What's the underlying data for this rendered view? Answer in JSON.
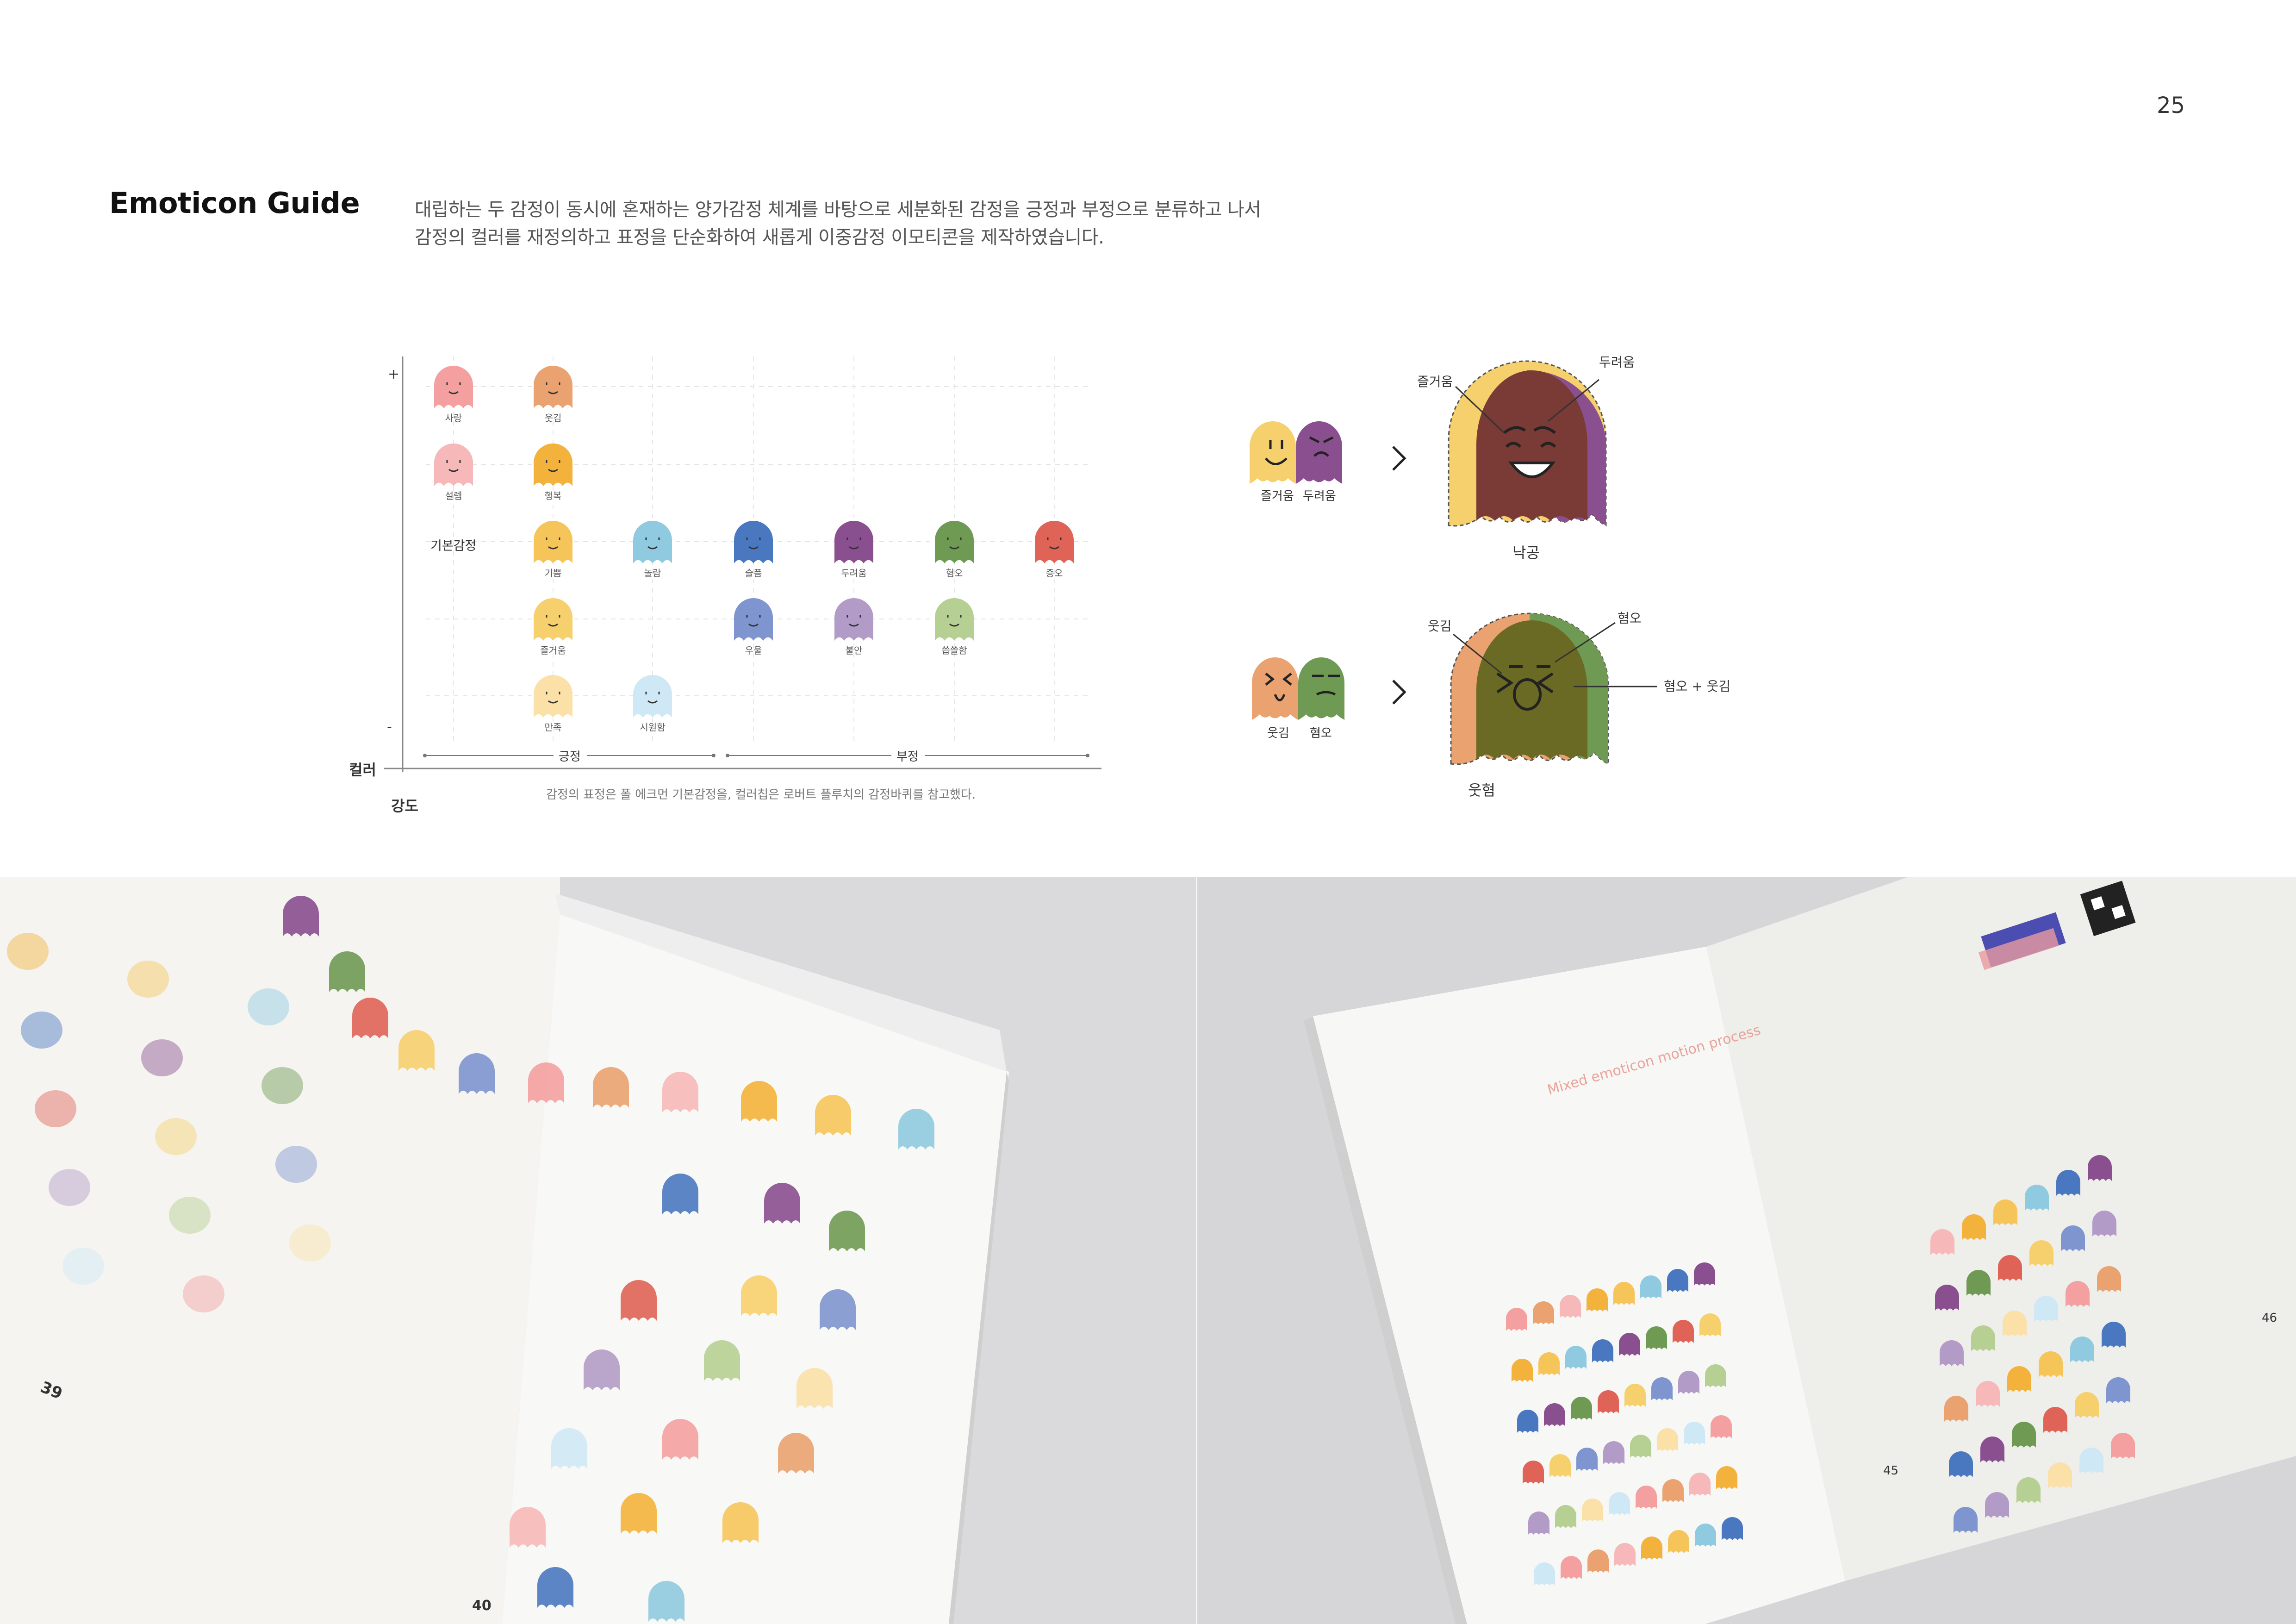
{
  "page_number": "25",
  "title": "Emoticon Guide",
  "description": [
    "대립하는 두 감정이 동시에 혼재하는 양가감정 체계를 바탕으로 세분화된 감정을 긍정과 부정으로 분류하고 나서",
    "감정의 컬러를 재정의하고 표정을 단순화하여 새롭게 이중감정 이모티콘을 제작하였습니다."
  ],
  "chart": {
    "y_plus": "+",
    "y_minus": "-",
    "row_label": "기본감정",
    "axis_color": "컬러",
    "axis_intensity": "강도",
    "group_positive": "긍정",
    "group_negative": "부정",
    "caption": "감정의 표정은 폴 에크먼 기본감정을, 컬러칩은 로버트 플루치의 감정바퀴를 참고했다.",
    "emoticons": [
      {
        "label": "사랑",
        "color": "#f4a0a0",
        "col": 0,
        "row": 0
      },
      {
        "label": "웃김",
        "color": "#e9a270",
        "col": 1,
        "row": 0
      },
      {
        "label": "설렘",
        "color": "#f6b8b8",
        "col": 0,
        "row": 1
      },
      {
        "label": "행복",
        "color": "#f3b23b",
        "col": 1,
        "row": 1
      },
      {
        "label": "기쁨",
        "color": "#f6c55a",
        "col": 1,
        "row": 2
      },
      {
        "label": "놀람",
        "color": "#8fcae0",
        "col": 2,
        "row": 2
      },
      {
        "label": "슬픔",
        "color": "#4a78c0",
        "col": 3,
        "row": 2
      },
      {
        "label": "두려움",
        "color": "#8a4f8f",
        "col": 4,
        "row": 2
      },
      {
        "label": "혐오",
        "color": "#6f9a53",
        "col": 5,
        "row": 2
      },
      {
        "label": "증오",
        "color": "#e06357",
        "col": 6,
        "row": 2
      },
      {
        "label": "즐거움",
        "color": "#f7d06e",
        "col": 1,
        "row": 3
      },
      {
        "label": "우울",
        "color": "#7f95cf",
        "col": 3,
        "row": 3
      },
      {
        "label": "불안",
        "color": "#b39bc7",
        "col": 4,
        "row": 3
      },
      {
        "label": "씁쓸함",
        "color": "#b6cf92",
        "col": 5,
        "row": 3
      },
      {
        "label": "만족",
        "color": "#fbe0a8",
        "col": 1,
        "row": 4
      },
      {
        "label": "시원함",
        "color": "#cfe8f5",
        "col": 2,
        "row": 4
      }
    ]
  },
  "mix_examples": [
    {
      "left_label": "즐거움",
      "right_label": "두려움",
      "left_color": "#f7d06e",
      "right_color": "#8a4f8f",
      "mixed_color": "#7a3a36",
      "callout_left": "즐거움",
      "callout_right": "두려움",
      "result": "낙공"
    },
    {
      "left_label": "웃김",
      "right_label": "혐오",
      "left_color": "#e9a270",
      "right_color": "#6f9a53",
      "mixed_color": "#6b6a24",
      "callout_left": "웃김",
      "callout_right": "혐오",
      "callout_mix": "혐오 + 웃김",
      "result": "웃혐"
    }
  ],
  "book_left": {
    "page_left": "39",
    "page_right": "40"
  },
  "book_right": {
    "page_left": "45",
    "page_right": "46",
    "heading": "Mixed emoticon motion process"
  }
}
